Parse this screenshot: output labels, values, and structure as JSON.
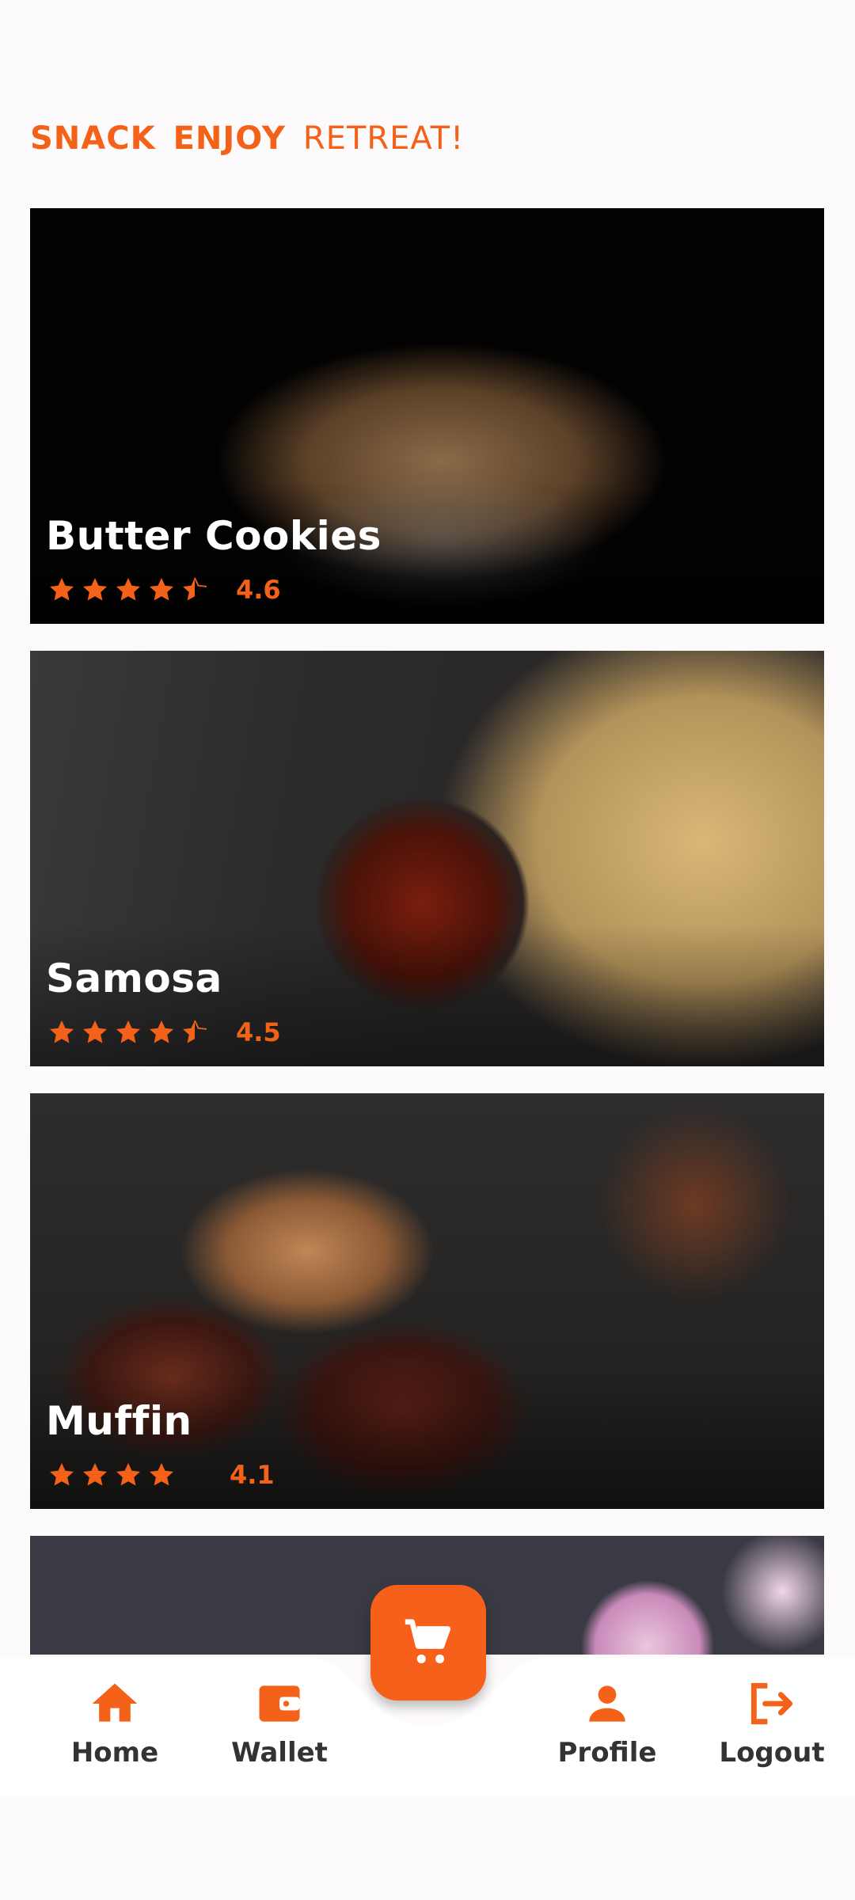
{
  "header": {
    "word1": "SNACK",
    "word2": "ENJOY",
    "word3": "RETREAT!"
  },
  "items": [
    {
      "name": "Butter Cookies",
      "rating": "4.6",
      "stars": 4.5
    },
    {
      "name": "Samosa",
      "rating": "4.5",
      "stars": 4.5
    },
    {
      "name": "Muffin",
      "rating": "4.1",
      "stars": 4.0
    },
    {
      "name": "",
      "rating": "",
      "stars": 0
    }
  ],
  "nav": {
    "home": "Home",
    "wallet": "Wallet",
    "profile": "Profile",
    "logout": "Logout"
  },
  "colors": {
    "accent": "#f4621a",
    "label": "#333333",
    "background": "#fdfafb"
  },
  "icons": [
    "home-icon",
    "wallet-icon",
    "cart-icon",
    "profile-icon",
    "logout-icon",
    "star-icon"
  ]
}
